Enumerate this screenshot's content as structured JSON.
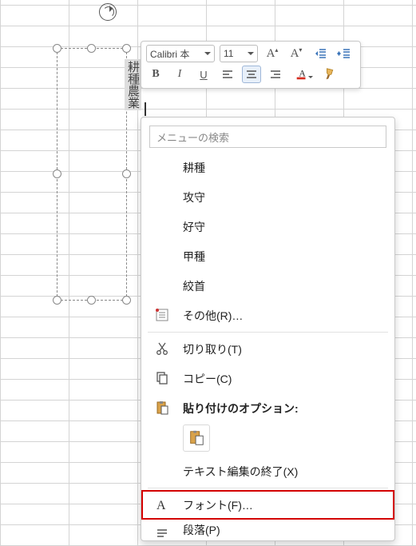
{
  "textbox": {
    "vertical_label": "耕種農業"
  },
  "minibar": {
    "font_name": "Calibri 本",
    "font_size": "11",
    "bold": "B",
    "italic": "I",
    "underline": "U"
  },
  "menu": {
    "search_placeholder": "メニューの検索",
    "ime": {
      "cand1": "耕種",
      "cand2": "攻守",
      "cand3": "好守",
      "cand4": "甲種",
      "cand5": "絞首",
      "other": "その他(R)…"
    },
    "cut": "切り取り(T)",
    "copy": "コピー(C)",
    "paste_label": "貼り付けのオプション:",
    "end_text_edit": "テキスト編集の終了(X)",
    "font": "フォント(F)…",
    "paragraph": "段落(P)"
  }
}
